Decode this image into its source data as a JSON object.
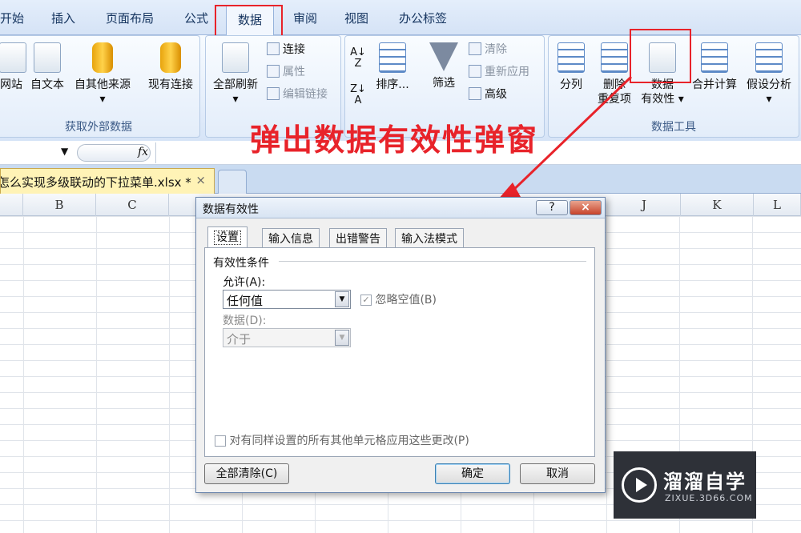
{
  "tabs": [
    "开始",
    "插入",
    "页面布局",
    "公式",
    "数据",
    "审阅",
    "视图",
    "办公标签"
  ],
  "ribbon": {
    "ext_group": {
      "label": "获取外部数据",
      "btn_web": "网站",
      "btn_text": "自文本",
      "btn_other": "自其他来源",
      "btn_existing": "现有连接"
    },
    "conn_group": {
      "btn_refresh": "全部刷新",
      "connect": "连接",
      "properties": "属性",
      "edit_links": "编辑链接"
    },
    "sort_group": {
      "btn_sort": "排序...",
      "btn_filter": "筛选",
      "clear": "清除",
      "reapply": "重新应用",
      "advanced": "高级"
    },
    "tools_group": {
      "label": "数据工具",
      "btn_split": "分列",
      "btn_dedup_1": "删除",
      "btn_dedup_2": "重复项",
      "btn_validation_1": "数据",
      "btn_validation_2": "有效性",
      "btn_consolidate": "合并计算",
      "btn_whatif": "假设分析"
    }
  },
  "formula_bar": {
    "fx": "fx"
  },
  "document_tab": {
    "title": "怎么实现多级联动的下拉菜单.xlsx *",
    "close": "×"
  },
  "columns": [
    "B",
    "C",
    "J",
    "K",
    "L"
  ],
  "annotation": "弹出数据有效性弹窗",
  "dialog": {
    "title": "数据有效性",
    "help": "?",
    "close": "×",
    "tabs": [
      "设置",
      "输入信息",
      "出错警告",
      "输入法模式"
    ],
    "section": "有效性条件",
    "allow_label": "允许(A):",
    "allow_value": "任何值",
    "ignore_blank": "忽略空值(B)",
    "data_label": "数据(D):",
    "data_value": "介于",
    "apply_all": "对有同样设置的所有其他单元格应用这些更改(P)",
    "clear_all": "全部清除(C)",
    "ok": "确定",
    "cancel": "取消"
  },
  "watermark": {
    "name": "溜溜自学",
    "url": "ZIXUE.3D66.COM"
  }
}
